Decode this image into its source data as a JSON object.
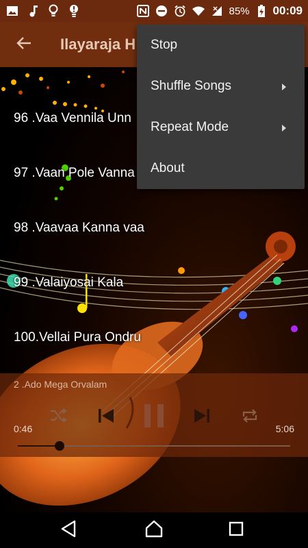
{
  "status_bar": {
    "left_icons": [
      "image-icon",
      "music-note-icon",
      "lightbulb-icon",
      "lightbulb-alert-icon"
    ],
    "right_icons": [
      "nfc-icon",
      "do-not-disturb-icon",
      "alarm-icon",
      "wifi-icon",
      "signal-icon"
    ],
    "battery": "85%",
    "time": "00:09"
  },
  "app_bar": {
    "title": "Ilayaraja H"
  },
  "songs": [
    {
      "label": "96 .Vaa Vennila Unn"
    },
    {
      "label": "97 .Vaan Pole Vanna"
    },
    {
      "label": "98 .Vaavaa Kanna vaa"
    },
    {
      "label": "99 .Valaiyosai Kala"
    },
    {
      "label": "100.Vellai Pura Ondru"
    }
  ],
  "player": {
    "now_playing": "2  .Ado Mega Orvalam",
    "current_time": "0:46",
    "total_time": "5:06",
    "progress": 0.153
  },
  "menu": {
    "items": [
      {
        "label": "Stop",
        "has_submenu": false
      },
      {
        "label": "Shuffle Songs",
        "has_submenu": true
      },
      {
        "label": "Repeat Mode",
        "has_submenu": true
      },
      {
        "label": "About",
        "has_submenu": false
      }
    ]
  },
  "colors": {
    "status_bar": "#6b2a0d",
    "app_bar": "#78320f",
    "menu_bg": "#3a3a3a",
    "player_bg": "#6e280a"
  }
}
